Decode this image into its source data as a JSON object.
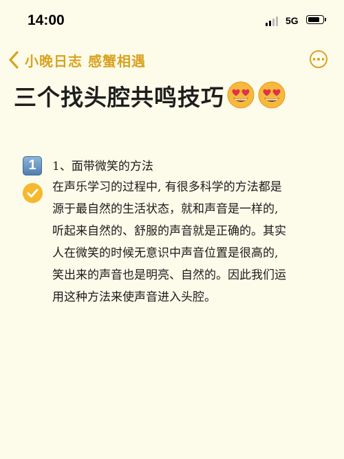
{
  "status_bar": {
    "time": "14:00",
    "network": "5G"
  },
  "nav": {
    "back_label": "小晚日志  感蟹相遇"
  },
  "article": {
    "title": "三个找头腔共鸣技巧",
    "section": {
      "badge": "1",
      "heading": "1、面带微笑的方法",
      "lines": [
        "在声乐学习的过程中, 有很多科学的方法都是",
        "源于最自然的生活状态，就和声音是一样的,",
        "听起来自然的、舒服的声音就是正确的。其实",
        "人在微笑的时候无意识中声音位置是很高的,",
        "笑出来的声音也是明亮、自然的。因此我们运",
        "用这种方法来使声音进入头腔。"
      ]
    }
  },
  "colors": {
    "accent": "#d9a321",
    "background": "#fdfbea",
    "check": "#f5b82e"
  },
  "icons": [
    "signal-icon",
    "battery-icon",
    "back-chevron-icon",
    "more-icon",
    "heart-eyes-emoji",
    "keycap-one-icon",
    "check-icon"
  ]
}
